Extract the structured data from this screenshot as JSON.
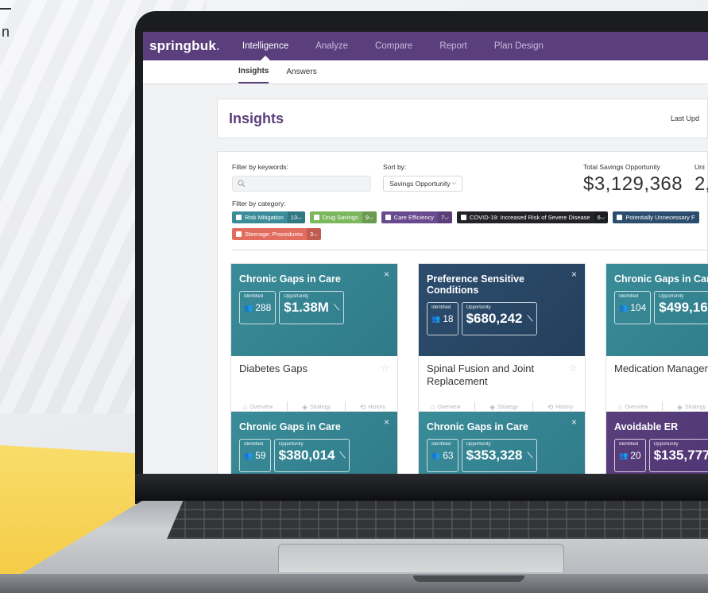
{
  "corner": {
    "text": "n"
  },
  "app": {
    "logo": "springbuk",
    "logo_dot": ".",
    "nav": [
      "Intelligence",
      "Analyze",
      "Compare",
      "Report",
      "Plan Design"
    ],
    "subnav": [
      "Insights",
      "Answers"
    ]
  },
  "header": {
    "title": "Insights",
    "last_updated": "Last Upd"
  },
  "filters": {
    "keywords_label": "Filter by keywords:",
    "search_placeholder": "",
    "sort_label": "Sort by:",
    "sort_value": "Savings Opportunity",
    "total_savings_label": "Total Savings Opportunity",
    "total_savings_value": "$3,129,368",
    "unique_label": "Uni",
    "unique_value": "2,",
    "category_label": "Filter by category:",
    "categories": [
      {
        "label": "Risk Mitigation",
        "count": "13",
        "color": "#3a8c99"
      },
      {
        "label": "Drug Savings",
        "count": "9",
        "color": "#7cb75e"
      },
      {
        "label": "Care Efficiency",
        "count": "7",
        "color": "#6a4a8e"
      },
      {
        "label": "COVID-19: Increased Risk of Severe Disease",
        "count": "6",
        "color": "#222326"
      },
      {
        "label": "Potentially Unnecessary F",
        "count": "",
        "color": "#2d4d6e"
      }
    ],
    "categories_row2": [
      {
        "label": "Steerage: Procedures",
        "count": "3",
        "color": "#e26d5f"
      }
    ]
  },
  "cards": [
    {
      "type": "Chronic Gaps in Care",
      "identified": "288",
      "opportunity": "$1.38M",
      "name": "Diabetes Gaps"
    },
    {
      "type": "Preference Sensitive Conditions",
      "identified": "18",
      "opportunity": "$680,242",
      "name": "Spinal Fusion and Joint Replacement"
    },
    {
      "type": "Chronic Gaps in Care",
      "identified": "104",
      "opportunity": "$499,16",
      "name": "Medication Managen"
    },
    {
      "type": "Chronic Gaps in Care",
      "identified": "59",
      "opportunity": "$380,014",
      "name": ""
    },
    {
      "type": "Chronic Gaps in Care",
      "identified": "63",
      "opportunity": "$353,328",
      "name": ""
    },
    {
      "type": "Avoidable ER",
      "identified": "20",
      "opportunity": "$135,777",
      "name": ""
    }
  ],
  "card_labels": {
    "identified": "Identified",
    "opportunity": "Opportunity",
    "close": "×",
    "overview": "Overview",
    "strategy": "Strategy",
    "history": "History"
  },
  "colors": {
    "brand_purple": "#5b3f7d",
    "teal": "#3a8c99",
    "navy": "#2d4d6e"
  }
}
